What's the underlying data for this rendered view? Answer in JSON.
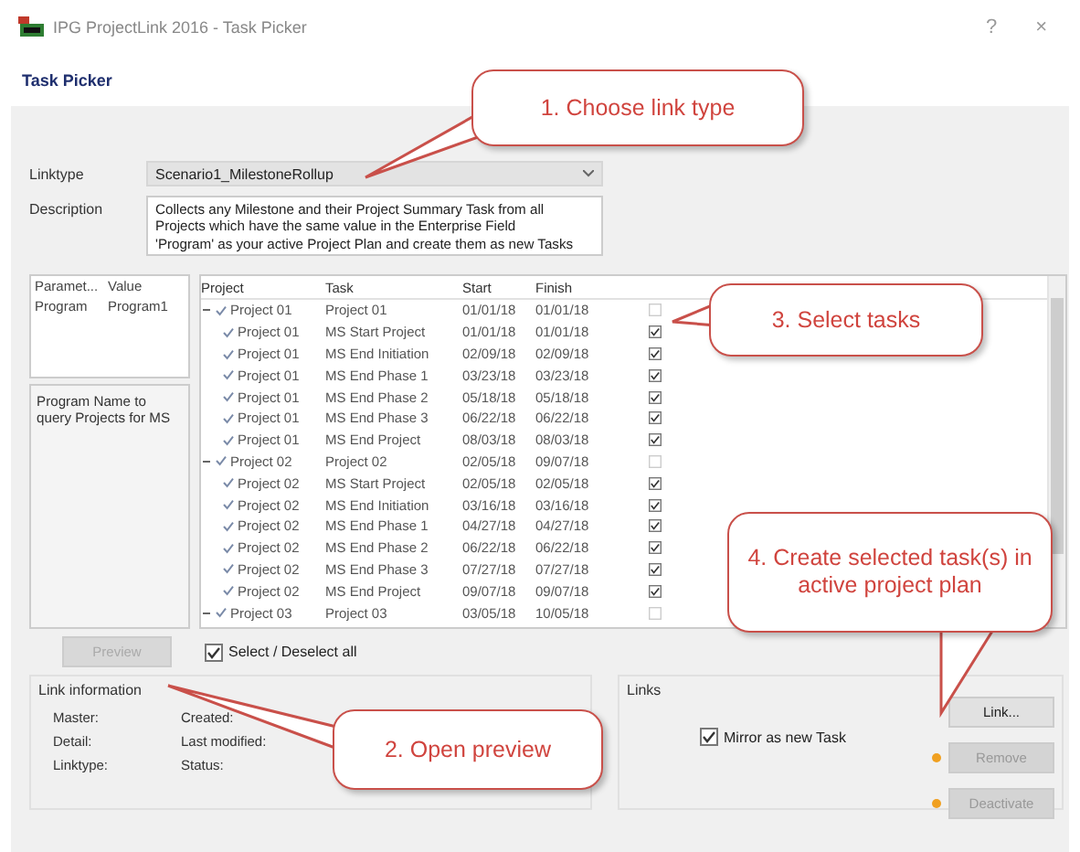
{
  "window": {
    "title": "IPG ProjectLink 2016 - Task Picker",
    "help": "?",
    "close": "×"
  },
  "header": {
    "title": "Task Picker"
  },
  "form": {
    "linktype": {
      "label": "Linktype",
      "value": "Scenario1_MilestoneRollup"
    },
    "description": {
      "label": "Description",
      "text": "Collects any Milestone and their Project Summary Task from all Projects which have the same value in the Enterprise Field 'Program' as your active Project Plan and create them as new Tasks"
    }
  },
  "parameters": {
    "columns": [
      "Paramet...",
      "Value"
    ],
    "rows": [
      {
        "name": "Program",
        "value": "Program1"
      }
    ],
    "hint": "Program Name to query Projects for MS"
  },
  "tasks": {
    "columns": [
      "Project",
      "Task",
      "Start",
      "Finish"
    ],
    "rows": [
      {
        "kind": "summary",
        "expanded": true,
        "checked": true,
        "project": "Project 01",
        "task": "Project 01",
        "start": "01/01/18",
        "finish": "01/01/18",
        "included": false
      },
      {
        "kind": "task",
        "checked": true,
        "project": "Project 01",
        "task": "MS Start Project",
        "start": "01/01/18",
        "finish": "01/01/18",
        "included": true
      },
      {
        "kind": "task",
        "checked": true,
        "project": "Project 01",
        "task": "MS End Initiation",
        "start": "02/09/18",
        "finish": "02/09/18",
        "included": true
      },
      {
        "kind": "task",
        "checked": true,
        "project": "Project 01",
        "task": "MS End Phase 1",
        "start": "03/23/18",
        "finish": "03/23/18",
        "included": true
      },
      {
        "kind": "task",
        "checked": true,
        "project": "Project 01",
        "task": "MS End Phase 2",
        "start": "05/18/18",
        "finish": "05/18/18",
        "included": true
      },
      {
        "kind": "task",
        "checked": true,
        "project": "Project 01",
        "task": "MS End Phase 3",
        "start": "06/22/18",
        "finish": "06/22/18",
        "included": true
      },
      {
        "kind": "task",
        "checked": true,
        "project": "Project 01",
        "task": "MS End Project",
        "start": "08/03/18",
        "finish": "08/03/18",
        "included": true
      },
      {
        "kind": "summary",
        "expanded": true,
        "checked": true,
        "project": "Project 02",
        "task": "Project 02",
        "start": "02/05/18",
        "finish": "09/07/18",
        "included": false
      },
      {
        "kind": "task",
        "checked": true,
        "project": "Project 02",
        "task": "MS Start Project",
        "start": "02/05/18",
        "finish": "02/05/18",
        "included": true
      },
      {
        "kind": "task",
        "checked": true,
        "project": "Project 02",
        "task": "MS End Initiation",
        "start": "03/16/18",
        "finish": "03/16/18",
        "included": true
      },
      {
        "kind": "task",
        "checked": true,
        "project": "Project 02",
        "task": "MS End Phase 1",
        "start": "04/27/18",
        "finish": "04/27/18",
        "included": true
      },
      {
        "kind": "task",
        "checked": true,
        "project": "Project 02",
        "task": "MS End Phase 2",
        "start": "06/22/18",
        "finish": "06/22/18",
        "included": true
      },
      {
        "kind": "task",
        "checked": true,
        "project": "Project 02",
        "task": "MS End Phase 3",
        "start": "07/27/18",
        "finish": "07/27/18",
        "included": true
      },
      {
        "kind": "task",
        "checked": true,
        "project": "Project 02",
        "task": "MS End Project",
        "start": "09/07/18",
        "finish": "09/07/18",
        "included": true
      },
      {
        "kind": "summary",
        "expanded": true,
        "checked": true,
        "project": "Project 03",
        "task": "Project 03",
        "start": "03/05/18",
        "finish": "10/05/18",
        "included": false
      }
    ]
  },
  "preview_button": {
    "label": "Preview",
    "disabled": true
  },
  "select_all": {
    "label": "Select / Deselect all",
    "checked": true
  },
  "link_information": {
    "title": "Link information",
    "fields": [
      "Master:",
      "Created:",
      "Detail:",
      "Last modified:",
      "Linktype:",
      "Status:"
    ]
  },
  "links": {
    "title": "Links",
    "mirror": {
      "label": "Mirror as new Task",
      "checked": true
    },
    "buttons": [
      {
        "label": "Link...",
        "disabled": false,
        "flagged": false
      },
      {
        "label": "Remove",
        "disabled": true,
        "flagged": true
      },
      {
        "label": "Deactivate",
        "disabled": true,
        "flagged": true
      }
    ]
  },
  "callouts": [
    "1. Choose link type",
    "2. Open preview",
    "3. Select tasks",
    "4. Create selected task(s) in active project plan"
  ]
}
